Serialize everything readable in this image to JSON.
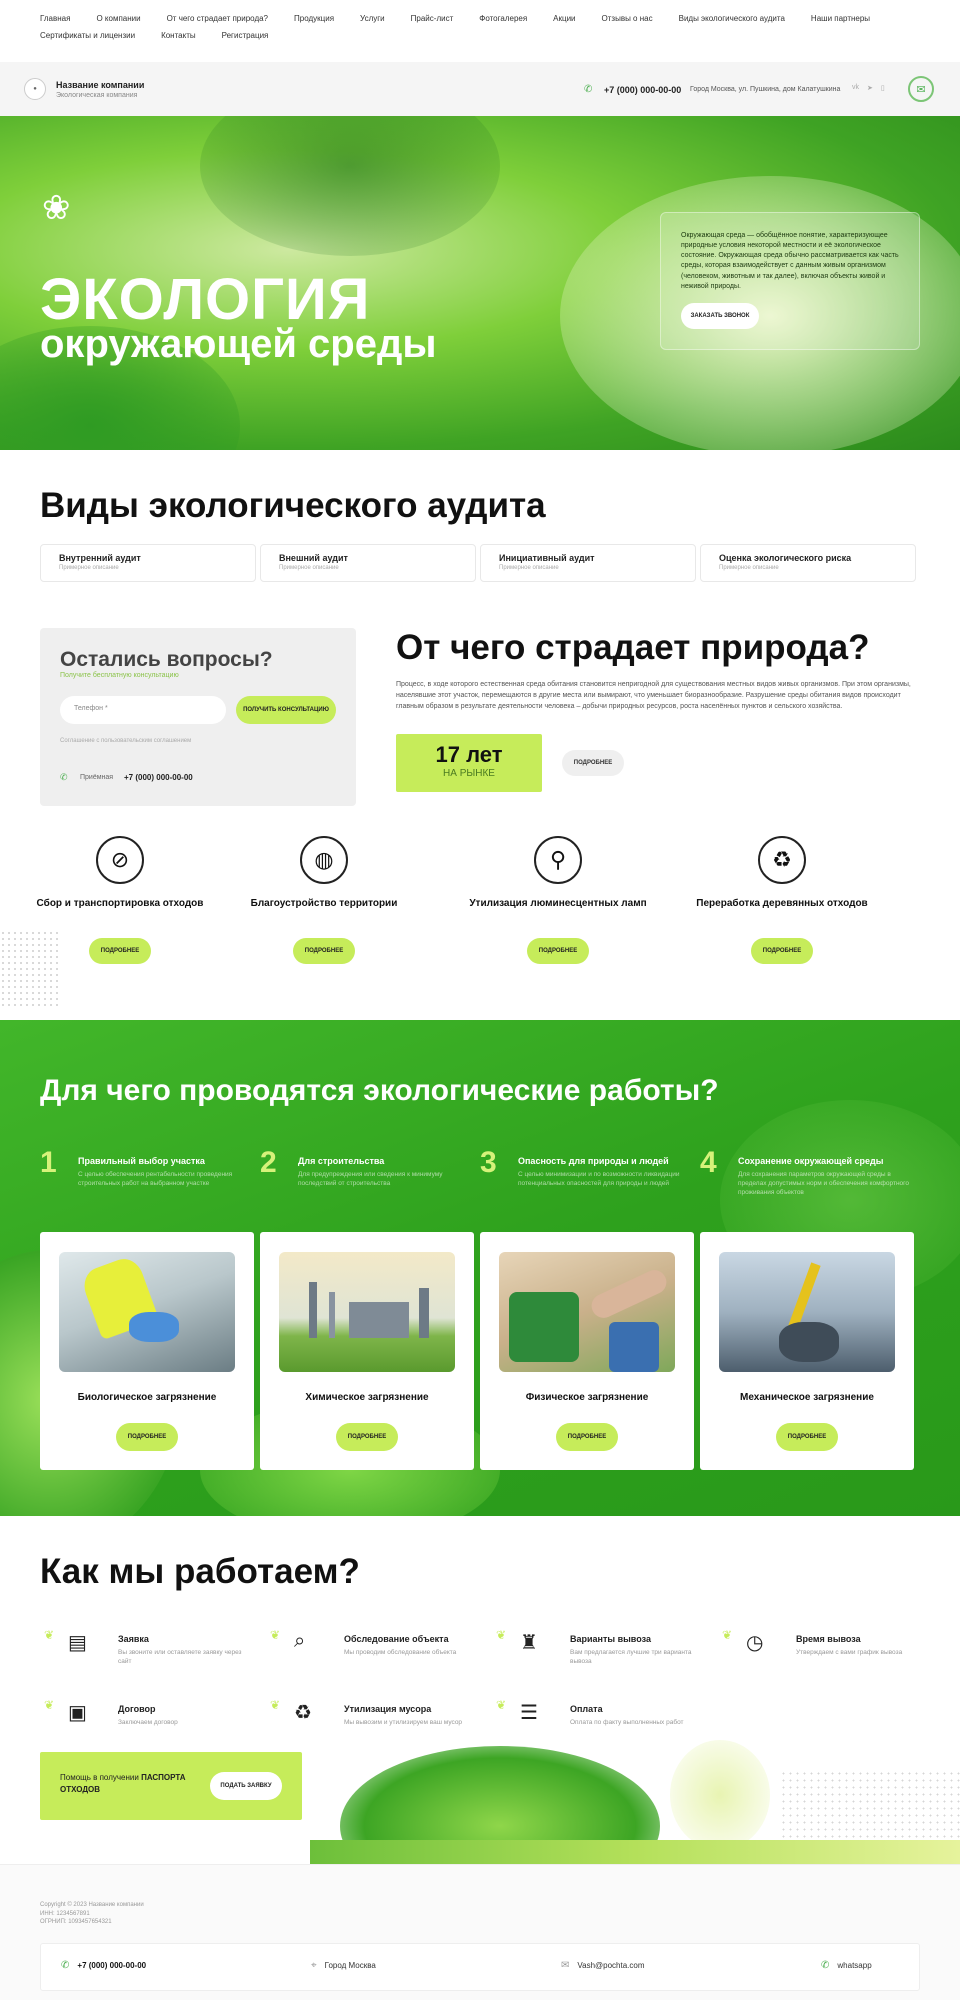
{
  "topnav": [
    "Главная",
    "О компании",
    "От чего страдает природа?",
    "Продукция",
    "Услуги",
    "Прайс-лист",
    "Фотогалерея",
    "Акции",
    "Отзывы о нас",
    "Виды экологического аудита",
    "Наши партнеры",
    "Сертификаты и лицензии",
    "Контакты",
    "Регистрация"
  ],
  "header": {
    "company_name": "Название компании",
    "company_tagline": "Экологическая компания",
    "phone": "+7 (000) 000-00-00",
    "address": "Город Москва, ул. Пушкина, дом Калатушкина"
  },
  "hero": {
    "title_line1": "ЭКОЛОГИЯ",
    "title_line2": "окружающей среды",
    "card_text": "Окружающая среда — обобщённое понятие, характеризующее природные условия некоторой местности и её экологическое состояние. Окружающая среда обычно рассматривается как часть среды, которая взаимодействует с данным живым организмом (человеком, животным и так далее), включая объекты живой и неживой природы.",
    "callback_label": "ЗАКАЗАТЬ ЗВОНОК"
  },
  "audit": {
    "title": "Виды экологического аудита",
    "tabs": [
      {
        "title": "Внутренний аудит",
        "sub": "Примерное описание"
      },
      {
        "title": "Внешний аудит",
        "sub": "Примерное описание"
      },
      {
        "title": "Инициативный аудит",
        "sub": "Примерное описание"
      },
      {
        "title": "Оценка экологического риска",
        "sub": "Примерное описание"
      }
    ]
  },
  "questions": {
    "title": "Остались вопросы?",
    "subtitle": "Получите бесплатную консультацию",
    "phone_placeholder": "Телефон *",
    "button": "ПОЛУЧИТЬ КОНСУЛЬТАЦИЮ",
    "consent": "Соглашение с пользовательским соглашением",
    "reception_label": "Приёмная",
    "reception_phone": "+7 (000) 000-00-00"
  },
  "suffers": {
    "title": "От чего страдает природа?",
    "text": "Процесс, в ходе которого естественная среда обитания становится непригодной для существования местных видов живых организмов. При этом организмы, населявшие этот участок, перемещаются в другие места или вымирают, что уменьшает биоразнообразие. Разрушение среды обитания видов происходит главным образом в результате деятельности человека – добычи природных ресурсов, роста населённых пунктов и сельского хозяйства.",
    "years_value": "17 лет",
    "years_label": "НА РЫНКЕ",
    "more_label": "ПОДРОБНЕЕ"
  },
  "services": [
    {
      "title": "Сбор и транспортировка отходов",
      "icon": "no-bottle-icon",
      "button": "ПОДРОБНЕЕ"
    },
    {
      "title": "Благоустройство территории",
      "icon": "globe-leaf-icon",
      "button": "ПОДРОБНЕЕ"
    },
    {
      "title": "Утилизация люминесцентных ламп",
      "icon": "lamp-icon",
      "button": "ПОДРОБНЕЕ"
    },
    {
      "title": "Переработка деревянных отходов",
      "icon": "tree-recycle-icon",
      "button": "ПОДРОБНЕЕ"
    }
  ],
  "why": {
    "title": "Для чего проводятся экологические работы?",
    "items": [
      {
        "num": "1",
        "title": "Правильный выбор участка",
        "text": "С целью обеспечения рентабельности проведения строительных работ на выбранном участке"
      },
      {
        "num": "2",
        "title": "Для строительства",
        "text": "Для предупреждения или сведения к минимуму последствий от строительства"
      },
      {
        "num": "3",
        "title": "Опасность для природы и людей",
        "text": "С целью минимизации и по возможности ликвидации потенциальных опасностей для природы и людей"
      },
      {
        "num": "4",
        "title": "Сохранение окружающей среды",
        "text": "Для сохранения параметров окружающей среды в пределах допустимых норм и обеспечения комфортного проживания объектов"
      }
    ]
  },
  "pollution": [
    {
      "title": "Биологическое загрязнение",
      "button": "ПОДРОБНЕЕ"
    },
    {
      "title": "Химическое загрязнение",
      "button": "ПОДРОБНЕЕ"
    },
    {
      "title": "Физическое загрязнение",
      "button": "ПОДРОБНЕЕ"
    },
    {
      "title": "Механическое загрязнение",
      "button": "ПОДРОБНЕЕ"
    }
  ],
  "how": {
    "title": "Как мы работаем?",
    "steps": [
      {
        "title": "Заявка",
        "text": "Вы звоните или оставляете заявку через сайт",
        "icon": "document-icon"
      },
      {
        "title": "Обследование объекта",
        "text": "Мы проводим обследование объекта",
        "icon": "inspect-icon"
      },
      {
        "title": "Варианты вывоза",
        "text": "Вам предлагается лучшие три варианта вывоза",
        "icon": "bag-icon"
      },
      {
        "title": "Время вывоза",
        "text": "Утверждаем с вами график вывоза",
        "icon": "clock-icon"
      },
      {
        "title": "Договор",
        "text": "Заключаем договор",
        "icon": "contract-icon"
      },
      {
        "title": "Утилизация мусора",
        "text": "Мы вывозим и утилизируем ваш мусор",
        "icon": "recycle-icon"
      },
      {
        "title": "Оплата",
        "text": "Оплата по факту выполненных работ",
        "icon": "payment-icon"
      }
    ]
  },
  "passport": {
    "text": "Помощь в получении",
    "bold": "ПАСПОРТА ОТХОДОВ",
    "button": "ПОДАТЬ ЗАЯВКУ"
  },
  "footer": {
    "copyright": "Copyright © 2023 Название компании",
    "inn": "ИНН: 1234567891",
    "ogrn": "ОГРНИП: 1093457654321",
    "phone": "+7 (000) 000-00-00",
    "city": "Город Москва",
    "email": "Vash@pochta.com",
    "whatsapp": "whatsapp"
  },
  "colors": {
    "accent": "#c6ec5a",
    "brand_green": "#2ea11d"
  }
}
